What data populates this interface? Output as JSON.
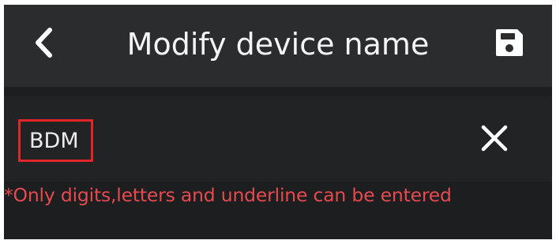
{
  "header": {
    "title": "Modify device name",
    "back_icon": "chevron-left-icon",
    "save_icon": "floppy-disk-icon"
  },
  "device_name": {
    "value": "BDM",
    "clear_icon": "close-icon"
  },
  "hint": {
    "text": "*Only digits,letters and underline can be entered"
  },
  "colors": {
    "background": "#1d1e20",
    "header_background": "#2b2c2e",
    "input_row_background": "#222325",
    "text": "#f4f4f4",
    "hint": "#e64a4e",
    "focus_border": "#e0262a"
  }
}
